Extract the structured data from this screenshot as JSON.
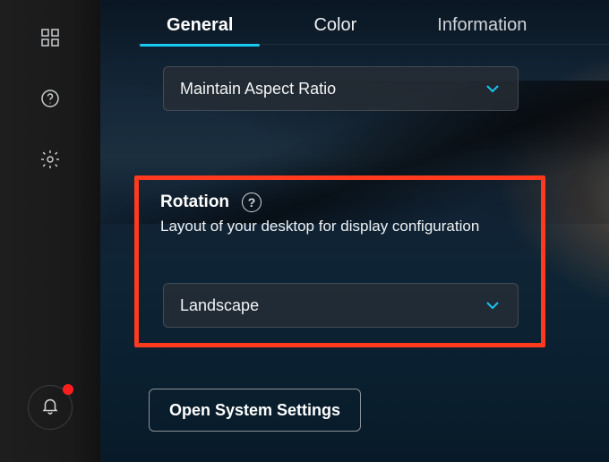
{
  "sidebar": {
    "icons": {
      "grid": "grid-icon",
      "help": "help-icon",
      "settings": "gear-icon",
      "bell": "bell-icon"
    },
    "has_notification": true
  },
  "tabs": {
    "items": [
      {
        "label": "General",
        "active": true
      },
      {
        "label": "Color",
        "active": false
      },
      {
        "label": "Information",
        "active": false
      }
    ]
  },
  "scaling_dropdown": {
    "value": "Maintain Aspect Ratio"
  },
  "rotation": {
    "title": "Rotation",
    "description": "Layout of your desktop for display configuration",
    "dropdown_value": "Landscape"
  },
  "system_button": {
    "label": "Open System Settings"
  }
}
